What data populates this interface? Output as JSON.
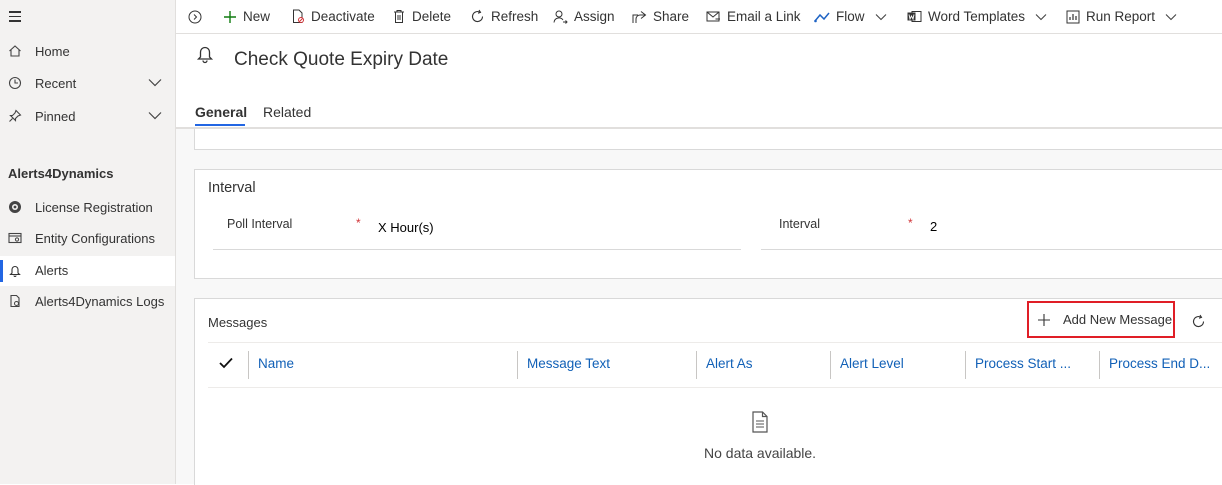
{
  "sidebar": {
    "items": [
      {
        "label": "Home",
        "icon": "home-icon"
      },
      {
        "label": "Recent",
        "icon": "clock-icon"
      },
      {
        "label": "Pinned",
        "icon": "pin-icon"
      }
    ],
    "area_title": "Alerts4Dynamics",
    "area_items": [
      {
        "label": "License Registration",
        "icon": "license-icon"
      },
      {
        "label": "Entity Configurations",
        "icon": "entity-config-icon"
      },
      {
        "label": "Alerts",
        "icon": "bell-icon",
        "selected": true
      },
      {
        "label": "Alerts4Dynamics Logs",
        "icon": "log-icon"
      }
    ]
  },
  "commandbar": {
    "new": "New",
    "deactivate": "Deactivate",
    "delete": "Delete",
    "refresh": "Refresh",
    "assign": "Assign",
    "share": "Share",
    "email_link": "Email a Link",
    "flow": "Flow",
    "word_templates": "Word Templates",
    "run_report": "Run Report"
  },
  "record": {
    "title": "Check Quote Expiry Date",
    "icon": "bell-icon"
  },
  "tabs": [
    {
      "label": "General",
      "active": true
    },
    {
      "label": "Related",
      "active": false
    }
  ],
  "interval_section": {
    "title": "Interval",
    "poll_interval": {
      "label": "Poll Interval",
      "required": "*",
      "value": "X Hour(s)"
    },
    "interval": {
      "label": "Interval",
      "required": "*",
      "value": "2"
    }
  },
  "messages_section": {
    "title": "Messages",
    "add_button": "Add New Message",
    "columns": [
      "Name",
      "Message Text",
      "Alert As",
      "Alert Level",
      "Process Start ...",
      "Process End D..."
    ],
    "empty_text": "No data available."
  },
  "colors": {
    "accent": "#2266e3",
    "link": "#1160b7",
    "required": "#d13438",
    "highlight_border": "#e01e26"
  }
}
